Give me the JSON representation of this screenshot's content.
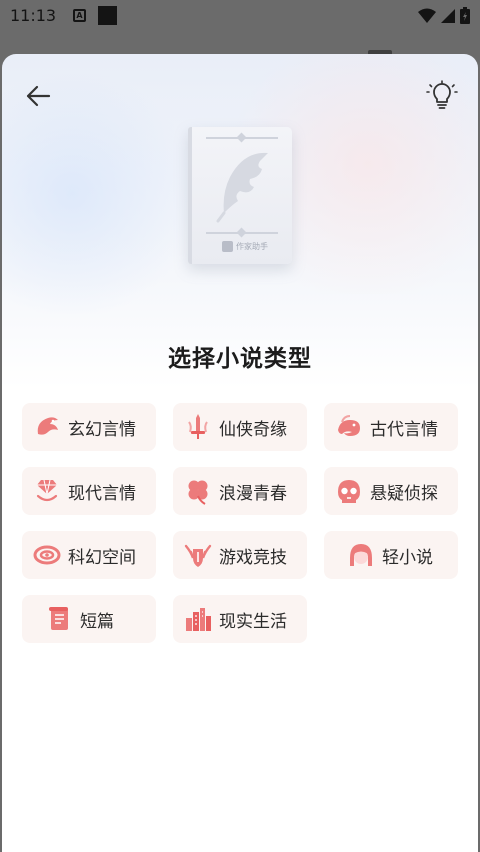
{
  "status_bar": {
    "time": "11:13",
    "notif_letter": "A"
  },
  "page": {
    "title": "选择小说类型"
  },
  "book": {
    "brand_text": "作家助手"
  },
  "colors": {
    "accent": "#e86a6a",
    "chip_bg": "#fbf4f2",
    "sheet_bg": "#ffffff"
  },
  "genres": [
    {
      "label": "玄幻言情",
      "icon": "dragon-icon"
    },
    {
      "label": "仙侠奇缘",
      "icon": "sword-icon"
    },
    {
      "label": "古代言情",
      "icon": "phoenix-icon"
    },
    {
      "label": "现代言情",
      "icon": "diamond-ring-icon"
    },
    {
      "label": "浪漫青春",
      "icon": "clover-icon"
    },
    {
      "label": "悬疑侦探",
      "icon": "skull-icon"
    },
    {
      "label": "科幻空间",
      "icon": "galaxy-icon"
    },
    {
      "label": "游戏竞技",
      "icon": "shield-wings-icon"
    },
    {
      "label": "轻小说",
      "icon": "girl-face-icon"
    },
    {
      "label": "短篇",
      "icon": "scroll-icon"
    },
    {
      "label": "现实生活",
      "icon": "city-icon"
    }
  ]
}
